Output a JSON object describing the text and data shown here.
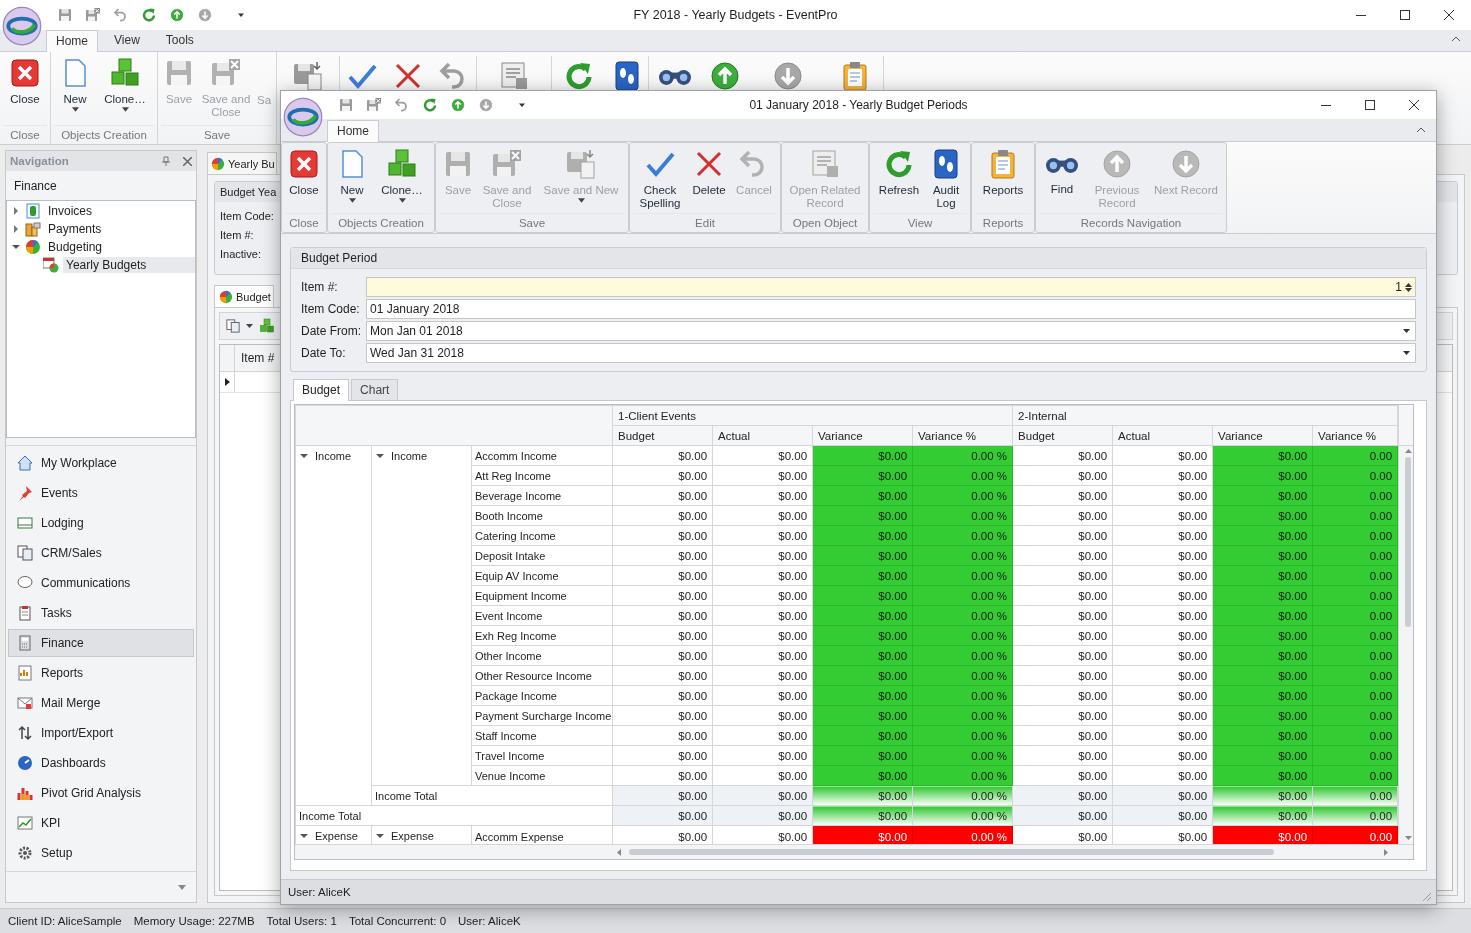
{
  "main_window": {
    "title": "FY 2018 - Yearly Budgets - EventPro",
    "ribbon_tabs": [
      {
        "label": "Home",
        "selected": true
      },
      {
        "label": "View",
        "selected": false
      },
      {
        "label": "Tools",
        "selected": false
      }
    ],
    "ribbon": {
      "groups": [
        {
          "label": "Close",
          "buttons": [
            {
              "label": "Close",
              "disabled": false,
              "dropdown": false
            }
          ]
        },
        {
          "label": "Objects Creation",
          "buttons": [
            {
              "label": "New",
              "disabled": false,
              "dropdown": true
            },
            {
              "label": "Clone…",
              "disabled": false,
              "dropdown": true
            }
          ]
        },
        {
          "label": "Save",
          "buttons": [
            {
              "label": "Save",
              "disabled": true,
              "dropdown": false
            },
            {
              "label": "Save and Close",
              "disabled": true,
              "dropdown": false
            },
            {
              "label": "Sa",
              "disabled": true,
              "dropdown": false
            }
          ]
        }
      ]
    },
    "navigation": {
      "title": "Navigation",
      "section": "Finance",
      "tree": [
        {
          "label": "Invoices",
          "expanded": false,
          "selected": false
        },
        {
          "label": "Payments",
          "expanded": false,
          "selected": false
        },
        {
          "label": "Budgeting",
          "expanded": true,
          "selected": false,
          "children": [
            {
              "label": "Yearly Budgets",
              "selected": true
            }
          ]
        }
      ],
      "modules": [
        {
          "label": "My Workplace",
          "selected": false
        },
        {
          "label": "Events",
          "selected": false
        },
        {
          "label": "Lodging",
          "selected": false
        },
        {
          "label": "CRM/Sales",
          "selected": false
        },
        {
          "label": "Communications",
          "selected": false
        },
        {
          "label": "Tasks",
          "selected": false
        },
        {
          "label": "Finance",
          "selected": true
        },
        {
          "label": "Reports",
          "selected": false
        },
        {
          "label": "Mail Merge",
          "selected": false
        },
        {
          "label": "Import/Export",
          "selected": false
        },
        {
          "label": "Dashboards",
          "selected": false
        },
        {
          "label": "Pivot Grid Analysis",
          "selected": false
        },
        {
          "label": "KPI",
          "selected": false
        },
        {
          "label": "Setup",
          "selected": false
        }
      ]
    },
    "document": {
      "tab": "Yearly Bu",
      "group_title": "Budget Yea",
      "field_labels": [
        "Item Code:",
        "Item #:",
        "Inactive:"
      ],
      "sub_tab": "Budget",
      "grid_column": "Item #"
    },
    "status_bar": [
      "Client ID: AliceSample",
      "Memory Usage: 227MB",
      "Total Users: 1",
      "Total Concurrent: 0",
      "User: AliceK"
    ]
  },
  "dialog": {
    "title": "01 January 2018 - Yearly Budget Periods",
    "ribbon_tabs": [
      {
        "label": "Home",
        "selected": true
      }
    ],
    "ribbon": {
      "groups": [
        {
          "label": "Close",
          "buttons": [
            {
              "label": "Close",
              "disabled": false,
              "dropdown": false
            }
          ]
        },
        {
          "label": "Objects Creation",
          "buttons": [
            {
              "label": "New",
              "disabled": false,
              "dropdown": true
            },
            {
              "label": "Clone…",
              "disabled": false,
              "dropdown": true
            }
          ]
        },
        {
          "label": "Save",
          "buttons": [
            {
              "label": "Save",
              "disabled": true,
              "dropdown": false
            },
            {
              "label": "Save and Close",
              "disabled": true,
              "dropdown": false
            },
            {
              "label": "Save and New",
              "disabled": true,
              "dropdown": true
            }
          ]
        },
        {
          "label": "Edit",
          "buttons": [
            {
              "label": "Check Spelling",
              "disabled": false,
              "dropdown": false
            },
            {
              "label": "Delete",
              "disabled": false,
              "dropdown": false
            },
            {
              "label": "Cancel",
              "disabled": true,
              "dropdown": false
            }
          ]
        },
        {
          "label": "Open Object",
          "buttons": [
            {
              "label": "Open Related Record",
              "disabled": true,
              "dropdown": false
            }
          ]
        },
        {
          "label": "View",
          "buttons": [
            {
              "label": "Refresh",
              "disabled": false,
              "dropdown": false
            },
            {
              "label": "Audit Log",
              "disabled": false,
              "dropdown": false
            }
          ]
        },
        {
          "label": "Reports",
          "buttons": [
            {
              "label": "Reports",
              "disabled": false,
              "dropdown": false
            }
          ]
        },
        {
          "label": "Records Navigation",
          "buttons": [
            {
              "label": "Find",
              "disabled": false,
              "dropdown": false
            },
            {
              "label": "Previous Record",
              "disabled": true,
              "dropdown": false
            },
            {
              "label": "Next Record",
              "disabled": true,
              "dropdown": false
            }
          ]
        }
      ]
    },
    "form": {
      "title": "Budget Period",
      "fields": [
        {
          "label": "Item #:",
          "value": "1",
          "kind": "spin"
        },
        {
          "label": "Item Code:",
          "value": "01 January 2018",
          "kind": "text"
        },
        {
          "label": "Date From:",
          "value": "Mon Jan 01 2018",
          "kind": "date"
        },
        {
          "label": "Date To:",
          "value": "Wed Jan 31 2018",
          "kind": "date"
        }
      ]
    },
    "tabs": [
      {
        "label": "Budget",
        "selected": true
      },
      {
        "label": "Chart",
        "selected": false
      }
    ],
    "grid": {
      "column_groups": [
        "1-Client Events",
        "2-Internal"
      ],
      "columns": [
        "Budget",
        "Actual",
        "Variance",
        "Variance %",
        "Budget",
        "Actual",
        "Variance",
        "Variance %"
      ],
      "groups": [
        {
          "label": "Income",
          "expanded": true,
          "subgroups": [
            {
              "label": "Income",
              "expanded": true,
              "items": [
                {
                  "label": "Accomm Income",
                  "values": [
                    "$0.00",
                    "$0.00",
                    "$0.00",
                    "0.00 %",
                    "$0.00",
                    "$0.00",
                    "$0.00",
                    "0.00"
                  ],
                  "favorable": true
                },
                {
                  "label": "Att Reg Income",
                  "values": [
                    "$0.00",
                    "$0.00",
                    "$0.00",
                    "0.00 %",
                    "$0.00",
                    "$0.00",
                    "$0.00",
                    "0.00"
                  ],
                  "favorable": true
                },
                {
                  "label": "Beverage Income",
                  "values": [
                    "$0.00",
                    "$0.00",
                    "$0.00",
                    "0.00 %",
                    "$0.00",
                    "$0.00",
                    "$0.00",
                    "0.00"
                  ],
                  "favorable": true
                },
                {
                  "label": "Booth Income",
                  "values": [
                    "$0.00",
                    "$0.00",
                    "$0.00",
                    "0.00 %",
                    "$0.00",
                    "$0.00",
                    "$0.00",
                    "0.00"
                  ],
                  "favorable": true
                },
                {
                  "label": "Catering Income",
                  "values": [
                    "$0.00",
                    "$0.00",
                    "$0.00",
                    "0.00 %",
                    "$0.00",
                    "$0.00",
                    "$0.00",
                    "0.00"
                  ],
                  "favorable": true
                },
                {
                  "label": "Deposit Intake",
                  "values": [
                    "$0.00",
                    "$0.00",
                    "$0.00",
                    "0.00 %",
                    "$0.00",
                    "$0.00",
                    "$0.00",
                    "0.00"
                  ],
                  "favorable": true
                },
                {
                  "label": "Equip AV Income",
                  "values": [
                    "$0.00",
                    "$0.00",
                    "$0.00",
                    "0.00 %",
                    "$0.00",
                    "$0.00",
                    "$0.00",
                    "0.00"
                  ],
                  "favorable": true
                },
                {
                  "label": "Equipment Income",
                  "values": [
                    "$0.00",
                    "$0.00",
                    "$0.00",
                    "0.00 %",
                    "$0.00",
                    "$0.00",
                    "$0.00",
                    "0.00"
                  ],
                  "favorable": true
                },
                {
                  "label": "Event Income",
                  "values": [
                    "$0.00",
                    "$0.00",
                    "$0.00",
                    "0.00 %",
                    "$0.00",
                    "$0.00",
                    "$0.00",
                    "0.00"
                  ],
                  "favorable": true
                },
                {
                  "label": "Exh Reg Income",
                  "values": [
                    "$0.00",
                    "$0.00",
                    "$0.00",
                    "0.00 %",
                    "$0.00",
                    "$0.00",
                    "$0.00",
                    "0.00"
                  ],
                  "favorable": true
                },
                {
                  "label": "Other Income",
                  "values": [
                    "$0.00",
                    "$0.00",
                    "$0.00",
                    "0.00 %",
                    "$0.00",
                    "$0.00",
                    "$0.00",
                    "0.00"
                  ],
                  "favorable": true
                },
                {
                  "label": "Other Resource Income",
                  "values": [
                    "$0.00",
                    "$0.00",
                    "$0.00",
                    "0.00 %",
                    "$0.00",
                    "$0.00",
                    "$0.00",
                    "0.00"
                  ],
                  "favorable": true
                },
                {
                  "label": "Package Income",
                  "values": [
                    "$0.00",
                    "$0.00",
                    "$0.00",
                    "0.00 %",
                    "$0.00",
                    "$0.00",
                    "$0.00",
                    "0.00"
                  ],
                  "favorable": true
                },
                {
                  "label": "Payment Surcharge Income",
                  "values": [
                    "$0.00",
                    "$0.00",
                    "$0.00",
                    "0.00 %",
                    "$0.00",
                    "$0.00",
                    "$0.00",
                    "0.00"
                  ],
                  "favorable": true
                },
                {
                  "label": "Staff Income",
                  "values": [
                    "$0.00",
                    "$0.00",
                    "$0.00",
                    "0.00 %",
                    "$0.00",
                    "$0.00",
                    "$0.00",
                    "0.00"
                  ],
                  "favorable": true
                },
                {
                  "label": "Travel Income",
                  "values": [
                    "$0.00",
                    "$0.00",
                    "$0.00",
                    "0.00 %",
                    "$0.00",
                    "$0.00",
                    "$0.00",
                    "0.00"
                  ],
                  "favorable": true
                },
                {
                  "label": "Venue Income",
                  "values": [
                    "$0.00",
                    "$0.00",
                    "$0.00",
                    "0.00 %",
                    "$0.00",
                    "$0.00",
                    "$0.00",
                    "0.00"
                  ],
                  "favorable": true
                }
              ],
              "total": {
                "label": "Income Total",
                "values": [
                  "$0.00",
                  "$0.00",
                  "$0.00",
                  "0.00 %",
                  "$0.00",
                  "$0.00",
                  "$0.00",
                  "0.00"
                ],
                "favorable": true
              }
            }
          ],
          "total": {
            "label": "Income Total",
            "values": [
              "$0.00",
              "$0.00",
              "$0.00",
              "0.00 %",
              "$0.00",
              "$0.00",
              "$0.00",
              "0.00"
            ],
            "favorable": true
          }
        },
        {
          "label": "Expense",
          "expanded": true,
          "subgroups": [
            {
              "label": "Expense",
              "expanded": true,
              "items": [
                {
                  "label": "Accomm Expense",
                  "values": [
                    "$0.00",
                    "$0.00",
                    "$0.00",
                    "0.00 %",
                    "$0.00",
                    "$0.00",
                    "$0.00",
                    "0.00"
                  ],
                  "favorable": false
                }
              ]
            }
          ]
        }
      ]
    },
    "status_bar": "User: AliceK"
  }
}
